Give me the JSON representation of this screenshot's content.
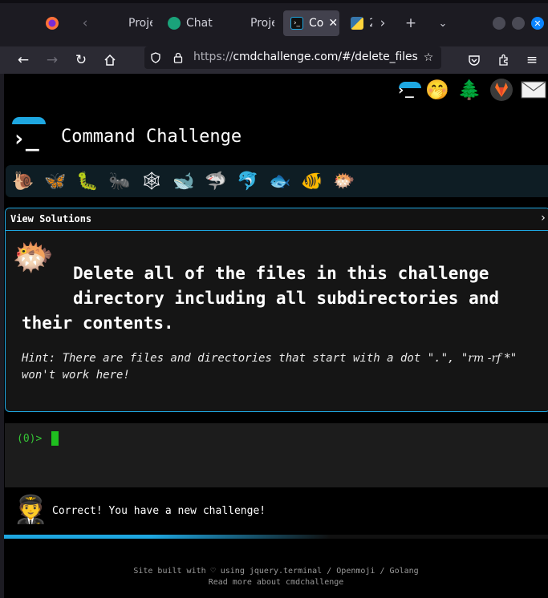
{
  "browser": {
    "tabs": [
      {
        "label": "Proje",
        "favicon": "page-icon"
      },
      {
        "label": "Chat",
        "favicon": "chatgpt-icon"
      },
      {
        "label": "Proje",
        "favicon": "page-icon"
      },
      {
        "label": "Co",
        "favicon": "terminal-icon",
        "active": true
      },
      {
        "label": "2",
        "favicon": "python-icon"
      }
    ],
    "url_scheme": "https://",
    "url_host": "cmdchallenge.com",
    "url_path": "/#/delete_files"
  },
  "site": {
    "title": "Command Challenge",
    "logo_glyph": "›_"
  },
  "top_emojis": [
    "terminal-emoji",
    "face-with-hand-over-mouth",
    "evergreen-tree",
    "gitlab-fox",
    "envelope"
  ],
  "animals": [
    "snail",
    "butterfly",
    "caterpillar",
    "ant",
    "spider-web",
    "whale",
    "shark",
    "dolphin",
    "fish",
    "tropical-fish",
    "blowfish"
  ],
  "challenge": {
    "solutions_label": "View Solutions",
    "chevron": "›",
    "lines": [
      "Delete all of the files in this challenge",
      "directory including all subdirectories and",
      "their contents."
    ],
    "hint_prefix": "Hint: There are files and directories that start with a dot \".\", \"",
    "hint_code": "rm -rf *",
    "hint_suffix": "\" won't work here!"
  },
  "terminal": {
    "prompt": "(0)>"
  },
  "status": {
    "message": "Correct! You have a new challenge!"
  },
  "progress": {
    "fraction": 0.6
  },
  "footer": {
    "line1_prefix": "Site built with",
    "heart": "♡",
    "line1_mid": "using",
    "jquery": "jquery.terminal",
    "sep1": "/",
    "openmoji": "Openmoji",
    "sep2": "/",
    "golang": "Golang",
    "line2_prefix": "Read more about",
    "about": "cmdchallenge"
  },
  "colors": {
    "accent": "#1ea7e1",
    "prompt_green": "#35c635",
    "page_bg": "#000000"
  }
}
